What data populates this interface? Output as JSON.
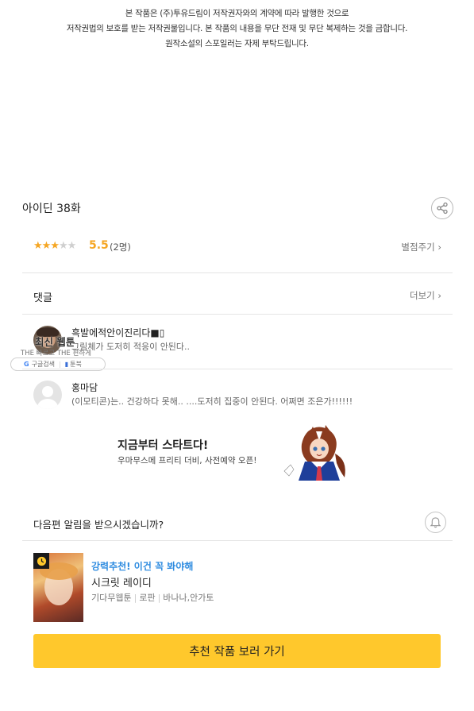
{
  "notice": {
    "line1": "본 작품은 (주)투유드림이 저작권자와의 계약에 따라 발행한 것으로",
    "line2": "저작권법의 보호를 받는 저작권물입니다. 본 작품의 내용을 무단 전재 및 무단 복제하는 것을 금합니다.",
    "line3": "원작소설의 스포일러는 자제 부탁드립니다."
  },
  "episode": {
    "title": "아이딘 38화",
    "share_icon": "share-icon"
  },
  "rating": {
    "stars_filled": 3,
    "stars_total": 5,
    "score": "5.5",
    "count": "(2명)",
    "rate_link": "별점주기 ›"
  },
  "comments": {
    "header": "댓글",
    "more_link": "더보기 ›",
    "items": [
      {
        "name": "흑발에적안이진리다■▯",
        "text": "그림체가 도저히 적응이 안된다..",
        "avatar": "photo"
      },
      {
        "name": "홍마담",
        "text": "(이모티콘)는.. 건강하다 못해.. ....도저히  집중이 안된다. 어쩌면 조은가!!!!!!",
        "avatar": "default"
      }
    ]
  },
  "overlay": {
    "title": "최신 웹툰",
    "subtitle": "THE 빠르고 THE 편하게",
    "search_label": "구글검색",
    "toonbook_label": "툰북"
  },
  "banner": {
    "title": "지금부터 스타트다!",
    "subtitle": "우마무스메 프리티 더비, 사전예약 오픈!"
  },
  "alert": {
    "question": "다음편 알림을 받으시겠습니까?",
    "icon": "bell-icon"
  },
  "recommendation": {
    "tag": "강력추천! 이건 꼭 봐야해",
    "title": "시크릿 레이디",
    "meta": [
      "기다무웹툰",
      "로판",
      "바나나,안가토"
    ],
    "badge_icon": "clock-icon"
  },
  "cta": {
    "label": "추천 작품 보러 가기"
  },
  "colors": {
    "accent_yellow": "#ffc82c",
    "star": "#f5a623",
    "tag_blue": "#2f8ce0"
  }
}
